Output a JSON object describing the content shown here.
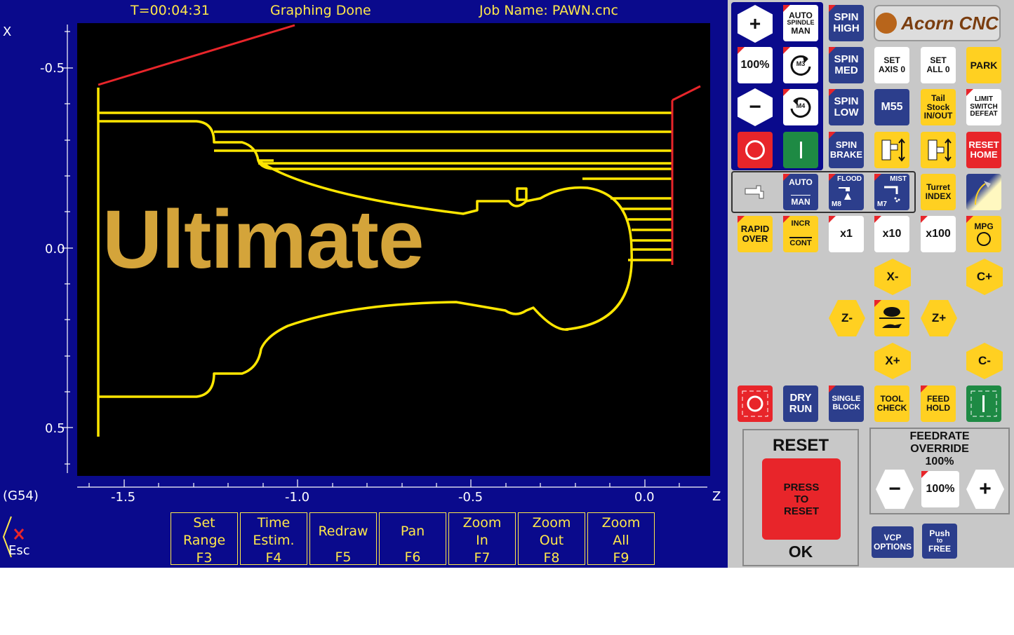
{
  "header": {
    "timer": "T=00:04:31",
    "status": "Graphing Done",
    "job": "Job Name: PAWN.cnc"
  },
  "plot": {
    "x_axis_label": "X",
    "z_axis_label": "Z",
    "x_ticks": [
      "-0.5",
      "0.0",
      "0.5"
    ],
    "z_ticks": [
      "-1.5",
      "-1.0",
      "-0.5",
      "0.0"
    ],
    "watermark": "Ultimate",
    "coord_system": "(G54)"
  },
  "esc": {
    "label": "Esc"
  },
  "fkeys": [
    {
      "label": "Set Range",
      "key": "F3"
    },
    {
      "label": "Time Estim.",
      "key": "F4"
    },
    {
      "label": "Redraw",
      "key": "F5"
    },
    {
      "label": "Pan",
      "key": "F6"
    },
    {
      "label": "Zoom In",
      "key": "F7"
    },
    {
      "label": "Zoom Out",
      "key": "F8"
    },
    {
      "label": "Zoom All",
      "key": "F9"
    }
  ],
  "vcp": {
    "logo": "Acorn CNC",
    "spindle_pct": "100%",
    "auto_spindle": [
      "AUTO",
      "SPINDLE",
      "MAN"
    ],
    "m3": "M3",
    "m4": "M4",
    "spin_high": [
      "SPIN",
      "HIGH"
    ],
    "spin_med": [
      "SPIN",
      "MED"
    ],
    "spin_low": [
      "SPIN",
      "LOW"
    ],
    "spin_brake": [
      "SPIN",
      "BRAKE"
    ],
    "set_axis": [
      "SET",
      "AXIS 0"
    ],
    "set_all": [
      "SET",
      "ALL 0"
    ],
    "park": "PARK",
    "m55": "M55",
    "tailstock": [
      "Tail",
      "Stock",
      "IN/OUT"
    ],
    "limit": [
      "LIMIT",
      "SWITCH",
      "DEFEAT"
    ],
    "reset_home": [
      "RESET",
      "HOME"
    ],
    "coolant_auto": [
      "AUTO",
      "MAN"
    ],
    "flood": [
      "FLOOD",
      "M8"
    ],
    "mist": [
      "MIST",
      "M7"
    ],
    "turret": [
      "Turret",
      "INDEX"
    ],
    "rapid": [
      "RAPID",
      "OVER"
    ],
    "incr": [
      "INCR",
      "CONT"
    ],
    "x1": "x1",
    "x10": "x10",
    "x100": "x100",
    "mpg": "MPG",
    "jog_x_minus": "X-",
    "jog_x_plus": "X+",
    "jog_z_minus": "Z-",
    "jog_z_plus": "Z+",
    "jog_c_plus": "C+",
    "jog_c_minus": "C-",
    "dry_run": [
      "DRY",
      "RUN"
    ],
    "single_block": [
      "SINGLE",
      "BLOCK"
    ],
    "tool_check": [
      "TOOL",
      "CHECK"
    ],
    "feed_hold": [
      "FEED",
      "HOLD"
    ],
    "reset_title": "RESET",
    "reset_btn": [
      "PRESS",
      "TO",
      "RESET"
    ],
    "reset_ok": "OK",
    "feedrate_title": [
      "FEEDRATE",
      "OVERRIDE"
    ],
    "feedrate_value": "100%",
    "feedrate_btn": "100%",
    "vcp_options": [
      "VCP",
      "OPTIONS"
    ],
    "push_free": [
      "Push",
      "to",
      "FREE"
    ]
  },
  "colors": {
    "background": "#0a0a8c",
    "toolpath": "#ffe600",
    "rapid": "#e8252a",
    "panel": "#c8c8c8",
    "accent": "#ffd021"
  }
}
